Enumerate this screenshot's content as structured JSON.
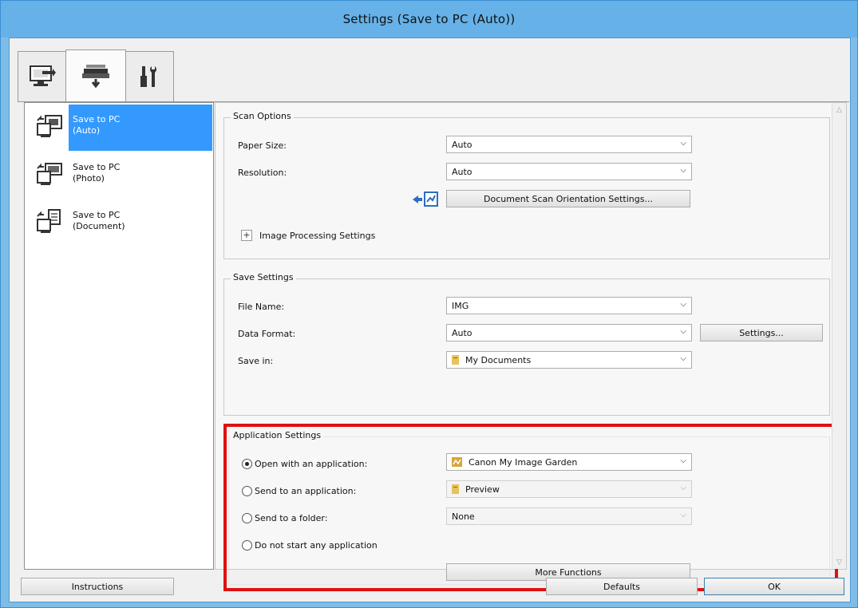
{
  "window": {
    "title": "Settings (Save to PC (Auto))"
  },
  "tabs": [
    {
      "name": "scan-from-computer-tab-icon"
    },
    {
      "name": "scan-from-operation-panel-tab-icon",
      "active": true
    },
    {
      "name": "general-settings-tab-icon"
    }
  ],
  "modes": [
    {
      "label": "Save to PC\n(Auto)",
      "selected": true
    },
    {
      "label": "Save to PC\n(Photo)"
    },
    {
      "label": "Save to PC\n(Document)"
    }
  ],
  "scan_options": {
    "title": "Scan Options",
    "paper_size_label": "Paper Size:",
    "paper_size_value": "Auto",
    "resolution_label": "Resolution:",
    "resolution_value": "Auto",
    "orientation_button": "Document Scan Orientation Settings...",
    "image_processing_label": "Image Processing Settings",
    "image_processing_toggle": "+"
  },
  "save_settings": {
    "title": "Save Settings",
    "file_name_label": "File Name:",
    "file_name_value": "IMG",
    "data_format_label": "Data Format:",
    "data_format_value": "Auto",
    "settings_button": "Settings...",
    "save_in_label": "Save in:",
    "save_in_value": "My Documents"
  },
  "application_settings": {
    "title": "Application Settings",
    "open_with_label": "Open with an application:",
    "open_with_value": "Canon My Image Garden",
    "send_to_app_label": "Send to an application:",
    "send_to_app_value": "Preview",
    "send_to_folder_label": "Send to a folder:",
    "send_to_folder_value": "None",
    "no_app_label": "Do not start any application",
    "more_functions_button": "More Functions",
    "selected_option": "open_with"
  },
  "footer": {
    "instructions_button": "Instructions",
    "defaults_button": "Defaults",
    "ok_button": "OK"
  },
  "colors": {
    "titlebar": "#66b1e8",
    "selection": "#3399ff",
    "highlight_box": "#e01010"
  }
}
